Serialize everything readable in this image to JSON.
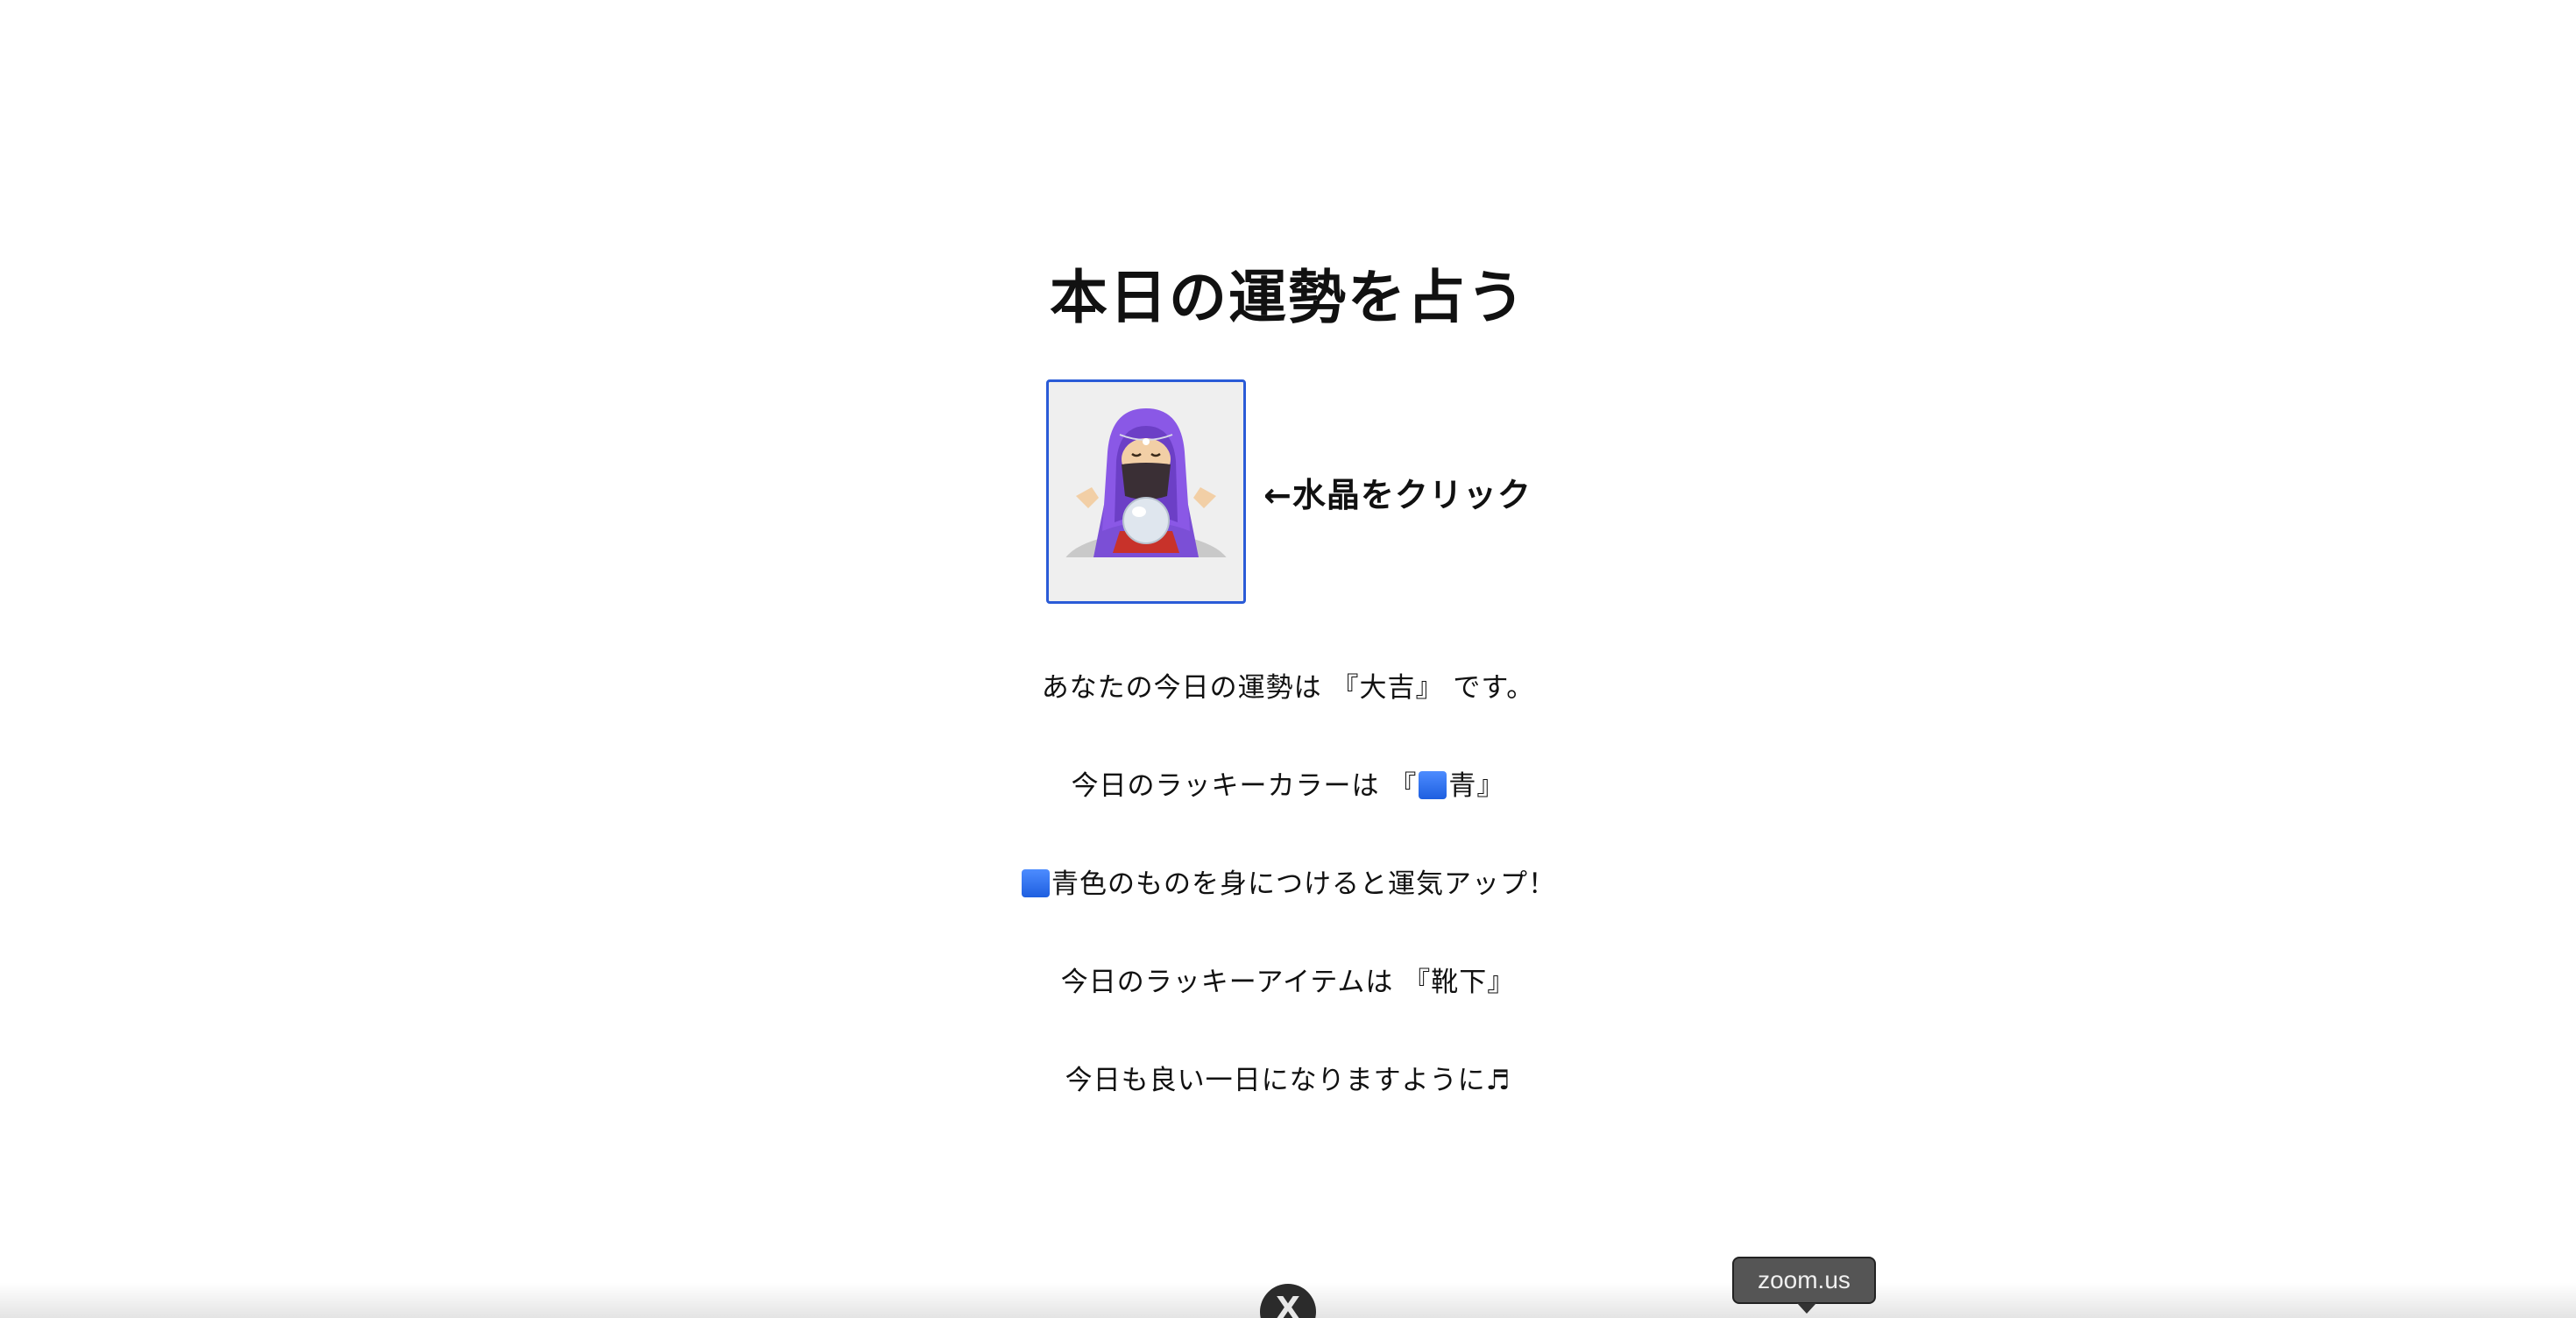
{
  "page": {
    "title": "本日の運勢を占う",
    "click_hint": "←水晶をクリック"
  },
  "crystal": {
    "icon": "fortune-teller-crystal-ball-icon"
  },
  "messages": {
    "fortune_prefix": "あなたの今日の運勢は 『大吉』 です。",
    "color_prefix": "今日のラッキーカラーは 『",
    "color_value": "青』",
    "color_advice": "青色のものを身につけると運気アップ！",
    "item": "今日のラッキーアイテムは 『靴下』",
    "closing": "今日も良い一日になりますように",
    "closing_icon": "♬"
  },
  "overlay": {
    "close_label": "X",
    "tooltip": "zoom.us"
  },
  "colors": {
    "accent_border": "#2a5bd7",
    "lucky_square": "#2f6ff0"
  }
}
